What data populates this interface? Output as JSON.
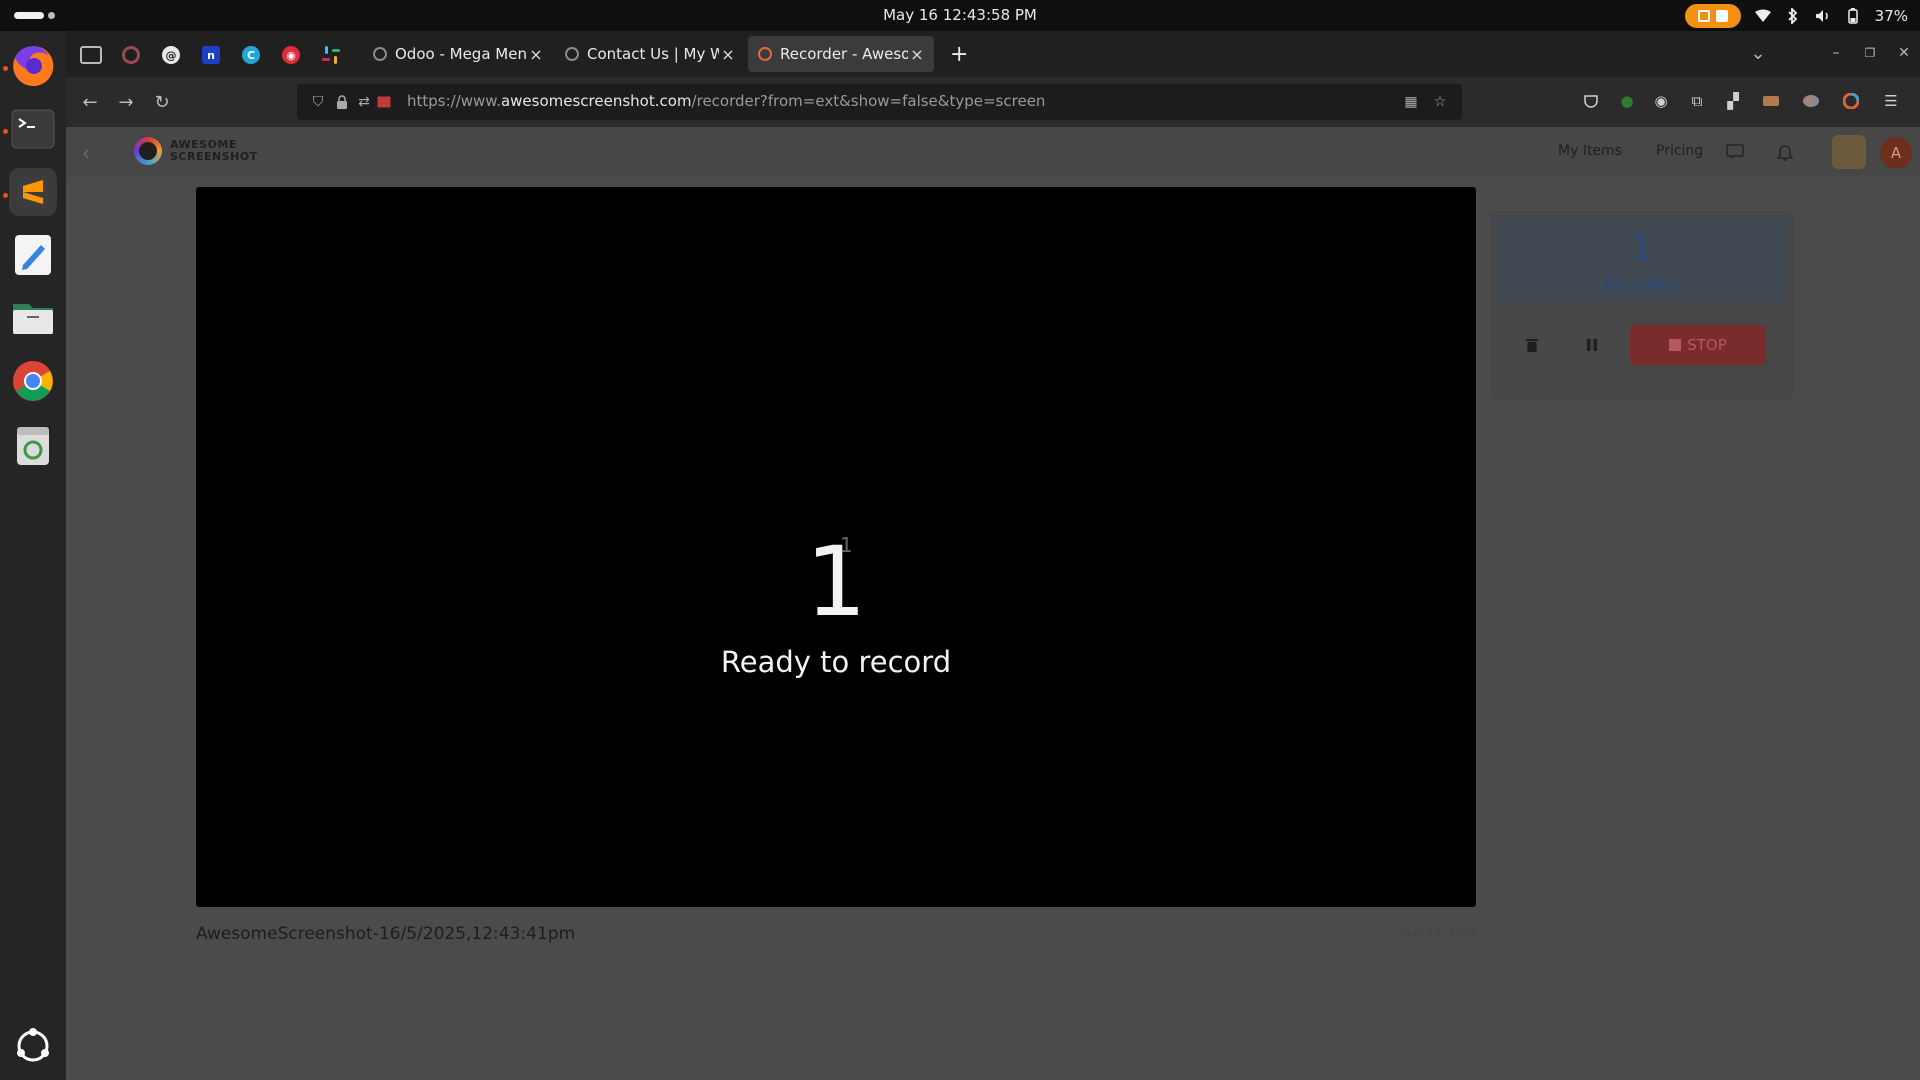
{
  "topbar": {
    "datetime": "May 16  12:43:58 PM",
    "battery": "37%"
  },
  "dock": {
    "items": [
      "Firefox",
      "Terminal",
      "Sublime Text",
      "Text Editor",
      "Files",
      "Google Chrome",
      "Trash",
      "Show Apps"
    ]
  },
  "browser": {
    "tabs": [
      {
        "title": "Odoo - Mega Menu URL S",
        "close": "×"
      },
      {
        "title": "Contact Us | My Website",
        "close": "×"
      },
      {
        "title": "Recorder - Awesome Scr",
        "close": "×"
      }
    ],
    "new_tab": "+",
    "url_prefix": "https://www.",
    "url_domain": "awesomescreenshot.com",
    "url_rest": "/recorder?from=ext&show=false&type=screen"
  },
  "app": {
    "logo_line1": "AWESOME",
    "logo_line2": "SCREENSHOT",
    "my_items": "My Items",
    "pricing": "Pricing",
    "avatar_letter": "A"
  },
  "stage": {
    "small_number": "1",
    "countdown": "1",
    "status": "Ready to record"
  },
  "recording": {
    "filename": "AwesomeScreenshot-16/5/2025,12:43:41pm",
    "date": "May 16, 2025",
    "count": "1",
    "count_label": "Recording",
    "stop_label": "STOP"
  },
  "colors": {
    "accent_orange": "#f29111",
    "stage_bg": "#000000",
    "stop_red": "#7a2b2b"
  }
}
